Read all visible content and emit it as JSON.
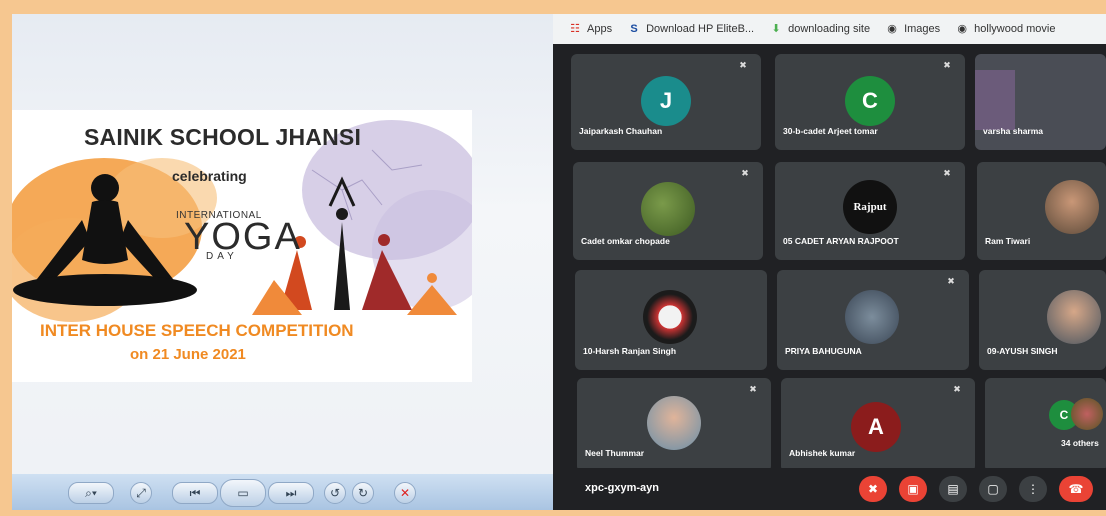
{
  "poster": {
    "title": "SAINIK SCHOOL JHANSI",
    "celebrating": "celebrating",
    "international": "INTERNATIONAL",
    "yoga": "YOGA",
    "day": "DAY",
    "competition": "INTER HOUSE SPEECH COMPETITION",
    "date": "on 21 June 2021"
  },
  "bookmarks": [
    {
      "label": "Apps",
      "icon": "apps-grid-icon"
    },
    {
      "label": "Download HP EliteB...",
      "icon": "s-logo-icon"
    },
    {
      "label": "downloading site",
      "icon": "download-arrow-icon"
    },
    {
      "label": "Images",
      "icon": "globe-icon"
    },
    {
      "label": "hollywood movie",
      "icon": "globe-icon"
    }
  ],
  "participants": [
    {
      "name": "Jaiparkash Chauhan",
      "initial": "J",
      "color": "#1a8c8c",
      "muted": true
    },
    {
      "name": "30-b-cadet Arjeet tomar",
      "initial": "C",
      "color": "#1e8e3e",
      "muted": true
    },
    {
      "name": "varsha sharma",
      "muted": false
    },
    {
      "name": "Cadet omkar chopade",
      "muted": true
    },
    {
      "name": "05 CADET ARYAN RAJPOOT",
      "logo": "Rajput",
      "muted": true
    },
    {
      "name": "Ram Tiwari",
      "muted": false
    },
    {
      "name": "10-Harsh Ranjan Singh",
      "muted": false
    },
    {
      "name": "PRIYA BAHUGUNA",
      "muted": true
    },
    {
      "name": "09-AYUSH SINGH",
      "muted": false
    },
    {
      "name": "Neel Thummar",
      "muted": true
    },
    {
      "name": "Abhishek kumar",
      "initial": "A",
      "color": "#8b1c1c",
      "muted": true
    },
    {
      "name": "34 others",
      "initial": "C",
      "color": "#1e8e3e",
      "muted": false
    }
  ],
  "meeting": {
    "code": "xpc-gxym-ayn"
  },
  "colors": {
    "frame": "#f6c790",
    "meet_bg": "#202124",
    "tile_bg": "#3c4043",
    "danger": "#ea4335",
    "accent_orange": "#f08a22"
  }
}
